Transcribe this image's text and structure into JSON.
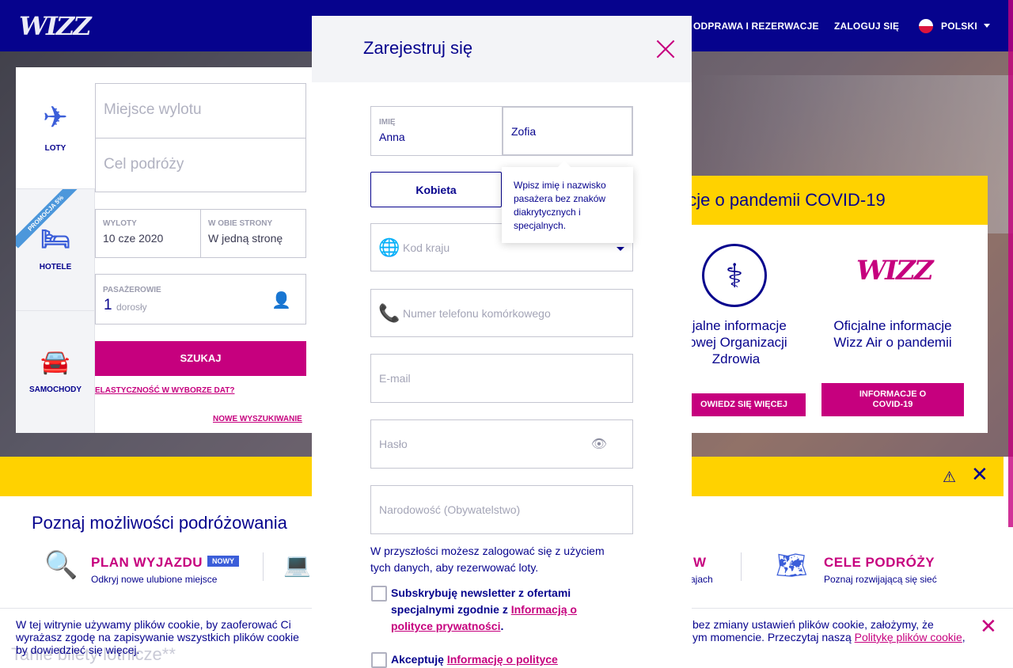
{
  "header": {
    "logo": "WIZZ",
    "nav": {
      "checkin": "ODPRAWA I REZERWACJE",
      "login": "ZALOGUJ SIĘ",
      "language": "POLSKI"
    }
  },
  "search": {
    "tabs": [
      {
        "label": "LOTY",
        "icon": "plane-icon"
      },
      {
        "label": "HOTELE",
        "icon": "bed-icon",
        "ribbon": "PROMOCJA 5%"
      },
      {
        "label": "SAMOCHODY",
        "icon": "car-icon"
      }
    ],
    "origin_placeholder": "Miejsce wylotu",
    "destination_placeholder": "Cel podróży",
    "departure_label": "WYLOTY",
    "departure_value": "10 cze 2020",
    "return_label": "W OBIE STRONY",
    "return_value": "W jedną stronę",
    "passengers_label": "PASAŻEROWIE",
    "passengers_count": "1",
    "passengers_unit": "dorosły",
    "search_button": "SZUKAJ",
    "flex_link": "ELASTYCZNOŚĆ W WYBORZE DAT?",
    "new_search_link": "NOWE WYSZUKIWANIE"
  },
  "covid": {
    "title": "acje o pandemii COVID-19",
    "who_text": "cjalne informacje\ntowej Organizacji\nZdrowia",
    "who_button": "OWIEDZ SIĘ WIĘCEJ",
    "wizz_text": "Oficjalne informacje\nWizz Air o pandemii",
    "wizz_button": "INFORMACJE O\nCOVID-19"
  },
  "explore": {
    "title": "Poznaj możliwości podróżowania",
    "features": [
      {
        "title": "PLAN WYJAZDU",
        "badge": "NOWY",
        "subtitle": "Odkryj nowe ulubione miejsce"
      },
      {
        "title": "W",
        "subtitle": "ajach"
      },
      {
        "title": "CELE PODRÓŻY",
        "subtitle": "Poznaj rozwijającą się sieć"
      }
    ]
  },
  "cookie": {
    "text_left": "W tej witrynie używamy plików cookie, by zaoferować Ci",
    "text_right": "bez zmiany ustawień plików cookie, założymy, że",
    "text_line2_left": "wyrażasz zgodę na zapisywanie wszystkich plików cookie",
    "text_line2_right": "ym momencie. Przeczytaj naszą",
    "link": "Politykę plików cookie",
    "text_line3": "by dowiedzieć się więcej.",
    "ghost": "Tanie bilety lotnicze**"
  },
  "modal": {
    "title": "Zarejestruj się",
    "first_name_label": "IMIĘ",
    "first_name_value": "Anna",
    "last_name_value": "Zofia",
    "gender_female": "Kobieta",
    "tooltip": "Wpisz imię i nazwisko pasażera bez znaków diakrytycznych i specjalnych.",
    "country_code_placeholder": "Kod kraju",
    "phone_placeholder": "Numer telefonu komórkowego",
    "email_placeholder": "E-mail",
    "password_placeholder": "Hasło",
    "nationality_placeholder": "Narodowość (Obywatelstwo)",
    "note": "W przyszłości możesz zalogować się z użyciem tych danych, aby rezerwować loty.",
    "newsletter_text": "Subskrybuję newsletter z ofertami specjalnymi zgodnie z",
    "newsletter_link": "Informacją o polityce prywatności",
    "accept_text": "Akceptuję",
    "accept_link": "Informację o polityce"
  },
  "colors": {
    "navy": "#06038d",
    "magenta": "#c6007e",
    "yellow": "#ffd200"
  }
}
